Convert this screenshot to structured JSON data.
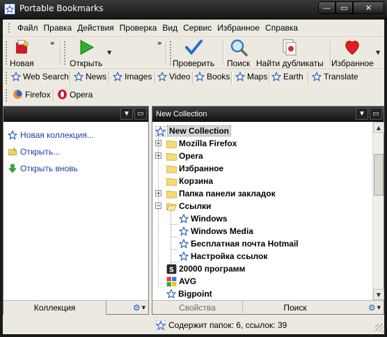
{
  "window": {
    "title": "Portable Bookmarks",
    "min_glyph": "—",
    "max_glyph": "▭",
    "close_glyph": "✕"
  },
  "menu": [
    "Файл",
    "Правка",
    "Действия",
    "Проверка",
    "Вид",
    "Сервис",
    "Избранное",
    "Справка"
  ],
  "toolbar": {
    "new_label": "Новая",
    "open_label": "Открыть",
    "check_label": "Проверить",
    "search_label": "Поиск",
    "duplicates_label": "Найти дубликаты",
    "favorites_label": "Избранное",
    "chevron": "»"
  },
  "links": {
    "row1": [
      "Web Search",
      "News",
      "Images",
      "Video",
      "Books",
      "Maps",
      "Earth",
      "Translate"
    ],
    "row2": [
      "Firefox",
      "Opera"
    ]
  },
  "left_pane": {
    "tasks": [
      "Новая коллекция...",
      "Открыть...",
      "Открыть вновь"
    ],
    "tab_label": "Коллекция"
  },
  "right_pane": {
    "header": "New Collection",
    "tree": [
      {
        "label": "New Collection",
        "icon": "star-icon",
        "level": 0,
        "expander": ""
      },
      {
        "label": "Mozilla Firefox",
        "icon": "folder-icon",
        "level": 1,
        "expander": "+"
      },
      {
        "label": "Opera",
        "icon": "folder-icon",
        "level": 1,
        "expander": "+"
      },
      {
        "label": "Избранное",
        "icon": "folder-icon",
        "level": 1,
        "expander": ""
      },
      {
        "label": "Корзина",
        "icon": "folder-icon",
        "level": 1,
        "expander": ""
      },
      {
        "label": "Папка панели закладок",
        "icon": "folder-icon",
        "level": 1,
        "expander": "+"
      },
      {
        "label": "Ссылки",
        "icon": "folder-open-icon",
        "level": 1,
        "expander": "−"
      },
      {
        "label": "Windows",
        "icon": "star-icon",
        "level": 2,
        "expander": ""
      },
      {
        "label": "Windows Media",
        "icon": "star-icon",
        "level": 2,
        "expander": ""
      },
      {
        "label": "Бесплатная почта Hotmail",
        "icon": "star-icon",
        "level": 2,
        "expander": ""
      },
      {
        "label": "Настройка ссылок",
        "icon": "star-icon",
        "level": 2,
        "expander": ""
      },
      {
        "label": "20000 программ",
        "icon": "softportal-icon",
        "level": 1,
        "expander": ""
      },
      {
        "label": "AVG",
        "icon": "avg-icon",
        "level": 1,
        "expander": ""
      },
      {
        "label": "Bigpoint",
        "icon": "star-icon",
        "level": 1,
        "expander": ""
      }
    ],
    "tab_properties": "Свойства",
    "tab_search": "Поиск"
  },
  "status": {
    "text": "Содержит папок: 6, ссылок: 39"
  },
  "colors": {
    "accent": "#2a5bb8",
    "titlebar": "#1e1e1e",
    "chrome": "#ece9e0"
  }
}
